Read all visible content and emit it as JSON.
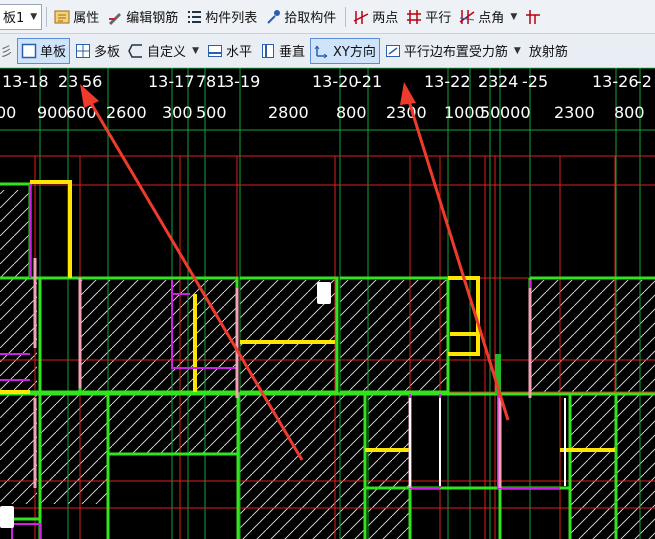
{
  "toolbar1": {
    "layer_select": "板1",
    "items": [
      "属性",
      "编辑钢筋",
      "构件列表",
      "拾取构件",
      "两点",
      "平行",
      "点角"
    ]
  },
  "toolbar2": {
    "partial_prefix": "彡",
    "items": [
      "单板",
      "多板",
      "自定义",
      "水平",
      "垂直",
      "XY方向",
      "平行边布置受力筋",
      "放射筋"
    ]
  },
  "axis_labels": [
    "13-18",
    "23",
    "56",
    "13-17",
    "7",
    "81",
    "3-19",
    "13-20",
    "-21",
    "13-22",
    "23",
    "24",
    "-25",
    "13-26",
    "-2"
  ],
  "dimensions": [
    "00",
    "900",
    "600",
    "2600",
    "300",
    "500",
    "2800",
    "800",
    "2300",
    "1000",
    "50",
    "000",
    "2300",
    "800"
  ],
  "colors": {
    "wall_green": "#33e31e",
    "axis_red": "#e0201d",
    "grid_green": "#14a538",
    "beam_yellow": "#ffe600",
    "rebar_magenta": "#d020e6",
    "arrow": "#ef3b2c"
  }
}
